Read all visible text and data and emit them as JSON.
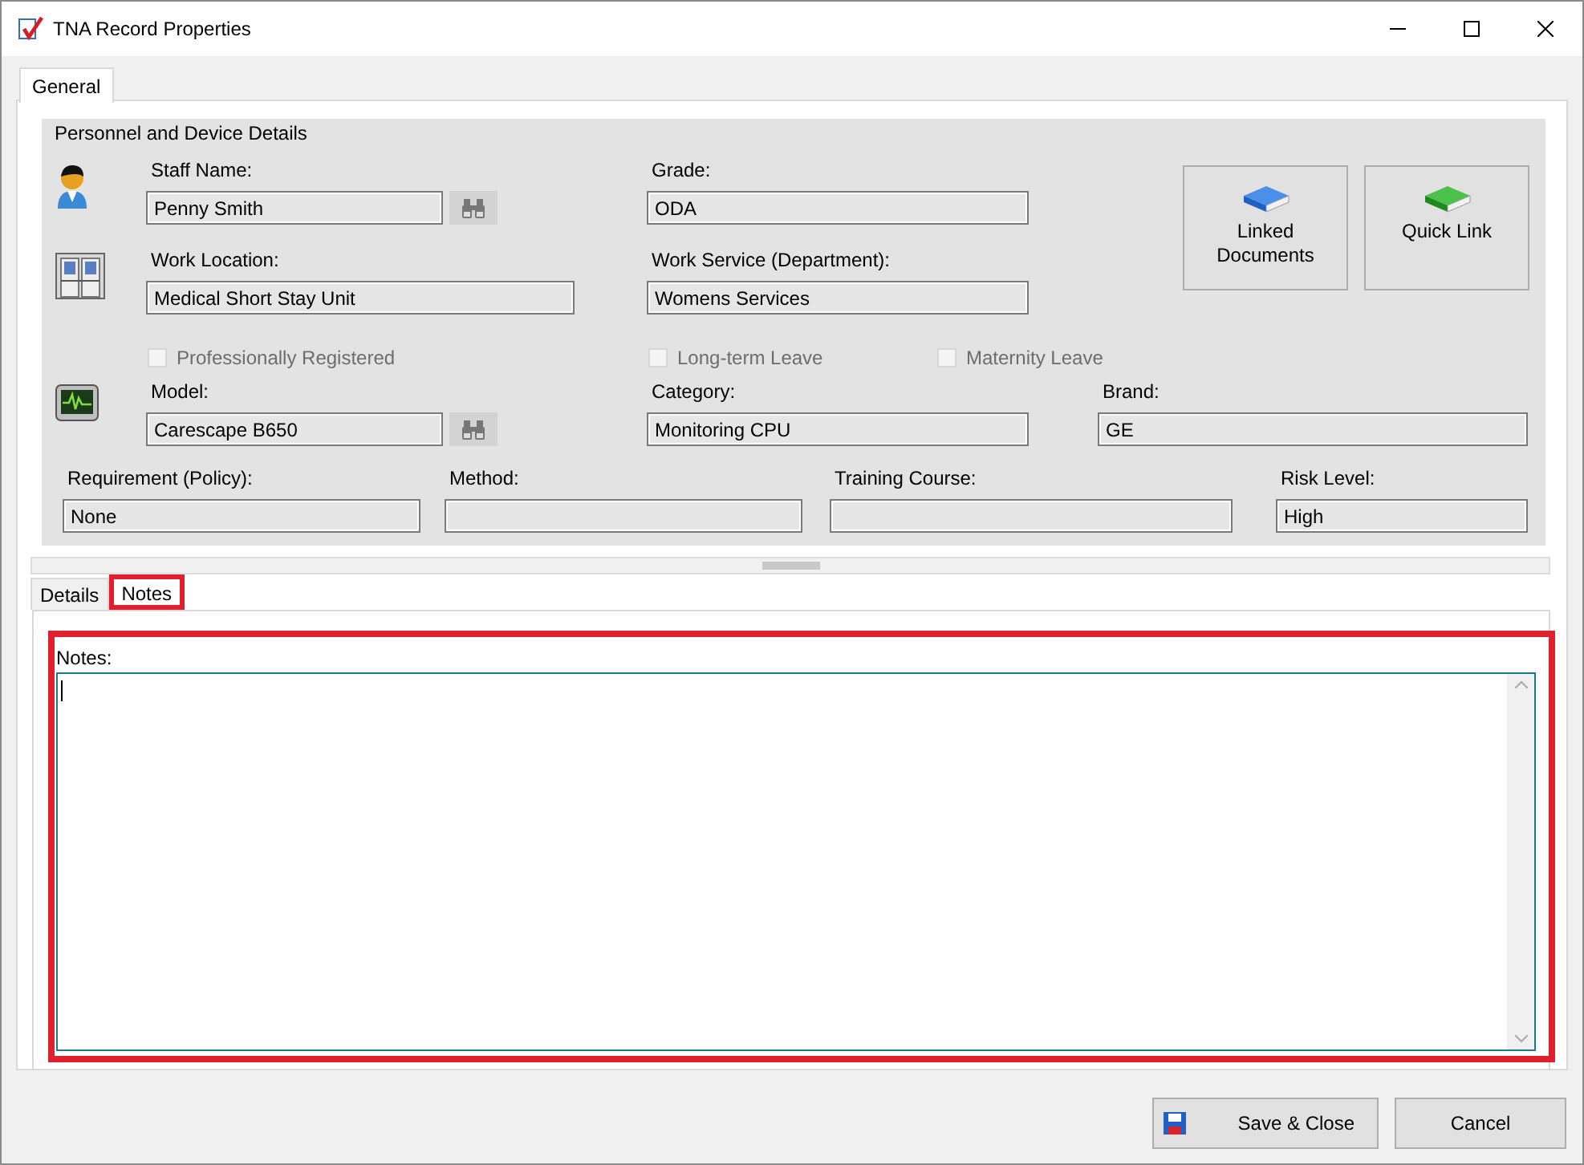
{
  "window": {
    "title": "TNA Record Properties"
  },
  "tabs": [
    {
      "label": "General",
      "selected": true
    }
  ],
  "group": {
    "title": "Personnel and Device Details",
    "fields": [
      {
        "label": "Staff Name:",
        "value": "Penny Smith",
        "lookup": true
      },
      {
        "label": "Grade:",
        "value": "ODA",
        "lookup": false
      },
      {
        "label": "Work Location:",
        "value": "Medical Short Stay Unit",
        "lookup": false
      },
      {
        "label": "Work Service (Department):",
        "value": "Womens Services",
        "lookup": false
      },
      {
        "label": "Model:",
        "value": "Carescape B650",
        "lookup": true
      },
      {
        "label": "Category:",
        "value": "Monitoring CPU",
        "lookup": false
      },
      {
        "label": "Brand:",
        "value": "GE",
        "lookup": false
      },
      {
        "label": "Requirement (Policy):",
        "value": "None",
        "lookup": false
      },
      {
        "label": "Method:",
        "lookup": false
      },
      {
        "label": "Training Course:",
        "lookup": false
      },
      {
        "label": "Risk Level:",
        "value": "High",
        "lookup": false
      }
    ],
    "checkboxes": [
      {
        "label": "Professionally Registered",
        "checked": false,
        "disabled": true
      },
      {
        "label": "Long-term Leave",
        "checked": false,
        "disabled": true
      },
      {
        "label": "Maternity Leave",
        "checked": false,
        "disabled": true
      }
    ],
    "buttons": [
      {
        "label": "Linked Documents",
        "kind": "blue"
      },
      {
        "label": "Quick Link",
        "kind": "green"
      }
    ]
  },
  "sub_tabs": [
    {
      "label": "Details",
      "selected": false,
      "highlighted": false
    },
    {
      "label": "Notes",
      "selected": true,
      "highlighted": true
    }
  ],
  "notes": {
    "label": "Notes:",
    "highlighted": true
  },
  "footer_buttons": [
    {
      "label": "Save & Close",
      "kind": "save"
    },
    {
      "label": "Cancel",
      "kind": "plain"
    }
  ]
}
